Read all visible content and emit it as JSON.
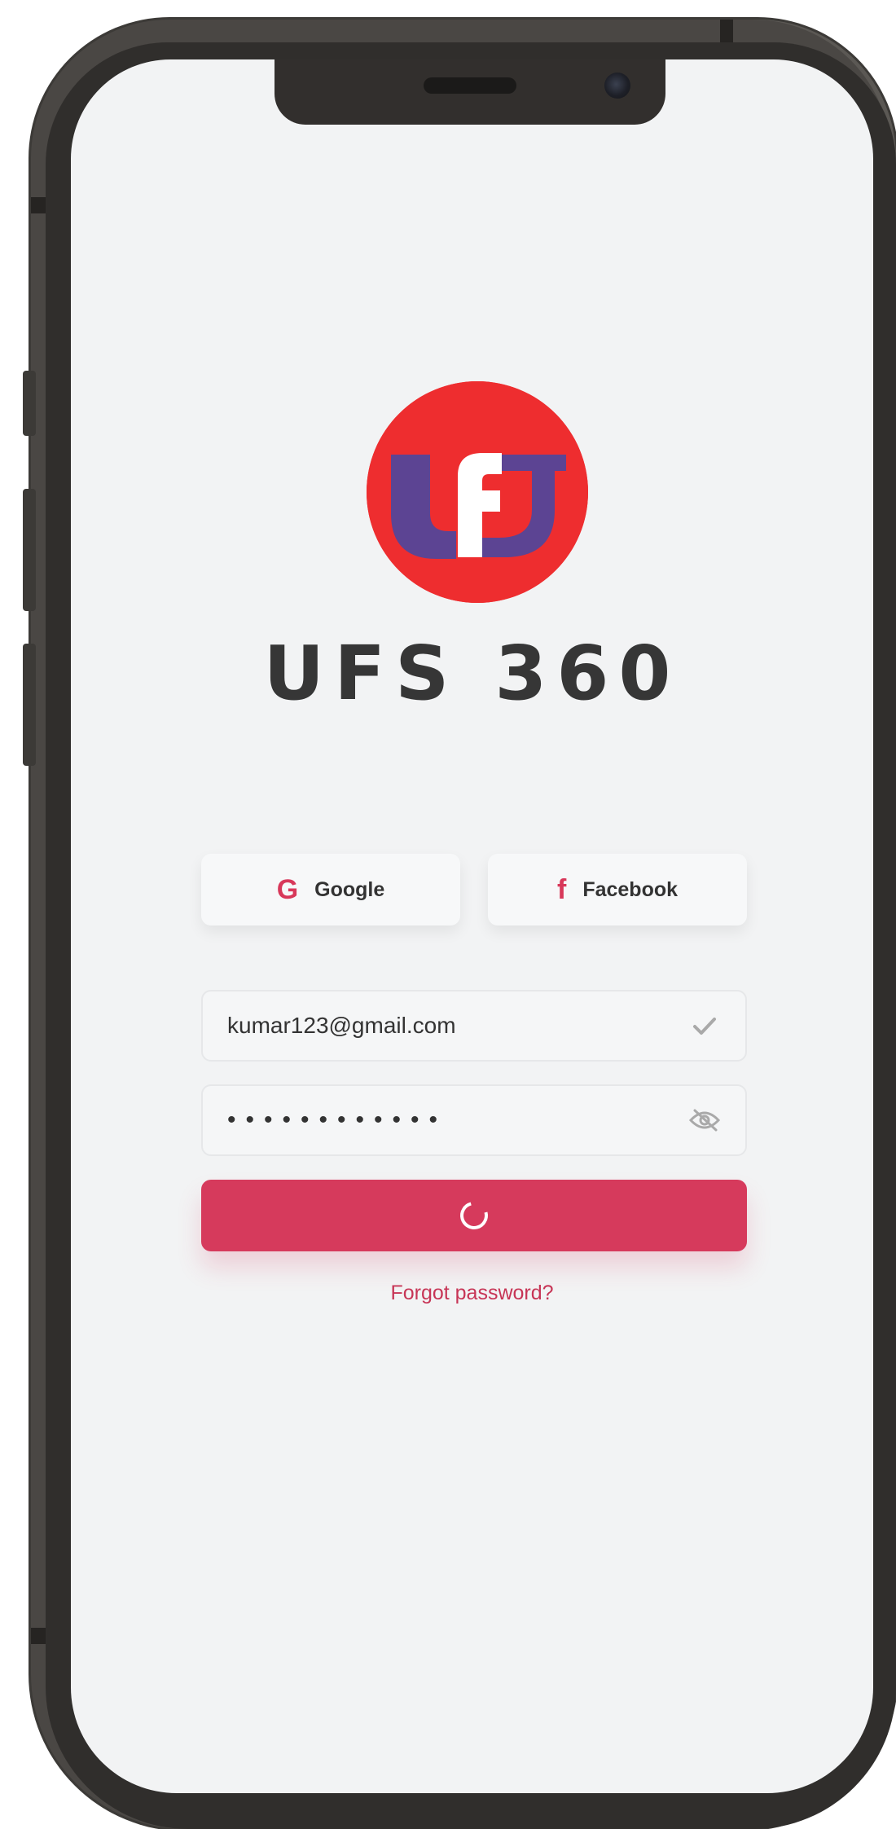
{
  "app": {
    "title": "UFS 360",
    "logo_text": "UFS"
  },
  "social": {
    "google_label": "Google",
    "google_icon": "G",
    "facebook_label": "Facebook",
    "facebook_icon": "f"
  },
  "form": {
    "email_value": "kumar123@gmail.com",
    "password_value": "••••••••••••"
  },
  "links": {
    "forgot_password": "Forgot password?"
  },
  "colors": {
    "accent": "#d63a5c",
    "logo_red": "#ee2d2f",
    "logo_purple": "#5c4493",
    "screen_bg": "#f2f3f4"
  },
  "icons": {
    "email_valid": "checkmark-icon",
    "password_toggle": "eye-off-icon",
    "submit_state": "loading-spinner-icon"
  }
}
